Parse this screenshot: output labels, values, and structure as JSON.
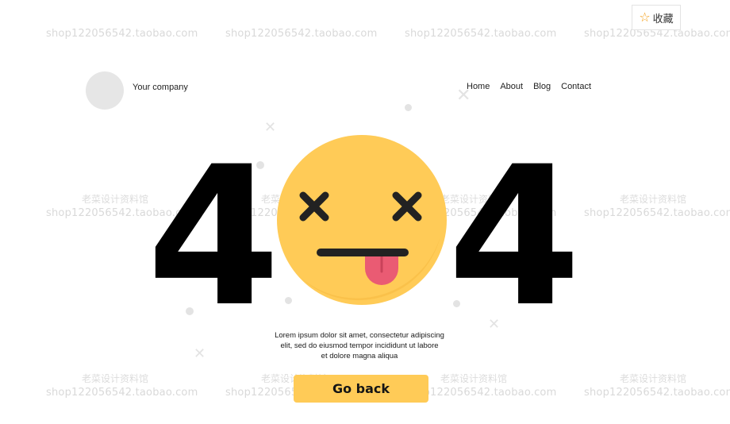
{
  "favorite": {
    "label": "收藏",
    "icon": "star-outline-icon",
    "icon_color": "#f29b0e"
  },
  "header": {
    "company_name": "Your company",
    "nav": [
      "Home",
      "About",
      "Blog",
      "Contact"
    ]
  },
  "error": {
    "digit_left": "4",
    "digit_right": "4",
    "emoji": "dizzy-face-tongue-out-icon",
    "emoji_color": "#ffcb57",
    "tongue_color": "#ea5b73"
  },
  "description": {
    "line1": "Lorem ipsum dolor sit amet, consectetur adipiscing",
    "line2": "elit, sed do eiusmod tempor incididunt ut labore",
    "line3": "et dolore magna aliqua"
  },
  "cta": {
    "label": "Go back",
    "color": "#ffcb57"
  },
  "watermarks": {
    "shop": "shop122056542.taobao.com",
    "cn": "老菜设计资料馆"
  }
}
